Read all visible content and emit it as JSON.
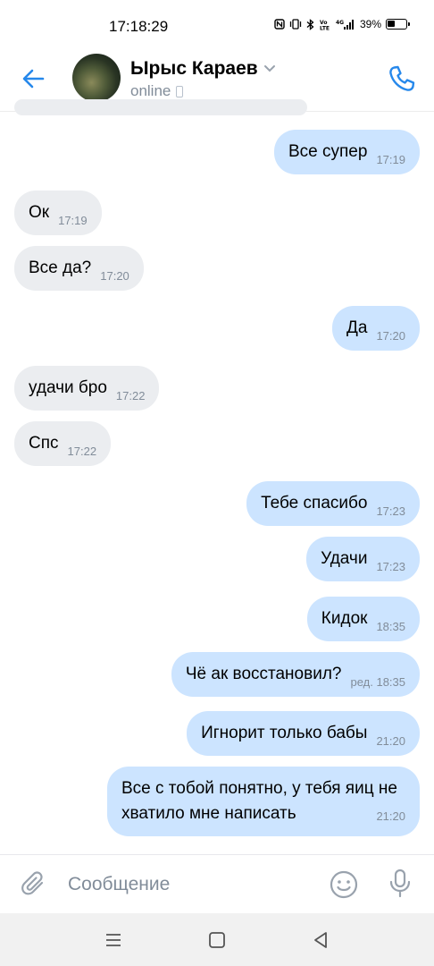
{
  "status_bar": {
    "time": "17:18:29",
    "indicators": [
      "nfc-icon",
      "vibrate-icon",
      "bluetooth-icon",
      "volte-icon",
      "signal-4g-icon"
    ],
    "battery": "39%"
  },
  "header": {
    "name": "Ырыс Караев",
    "status": "online"
  },
  "messages": [
    {
      "dir": "out",
      "text": "Все супер",
      "time": "17:19"
    },
    {
      "dir": "in",
      "text": "Ок",
      "time": "17:19"
    },
    {
      "dir": "in",
      "text": "Все да?",
      "time": "17:20"
    },
    {
      "dir": "out",
      "text": "Да",
      "time": "17:20"
    },
    {
      "dir": "in",
      "text": "удачи бро",
      "time": "17:22"
    },
    {
      "dir": "in",
      "text": "Спс",
      "time": "17:22"
    },
    {
      "dir": "out",
      "text": "Тебе спасибо",
      "time": "17:23"
    },
    {
      "dir": "out",
      "text": "Удачи",
      "time": "17:23"
    },
    {
      "dir": "out",
      "text": "Кидок",
      "time": "18:35"
    },
    {
      "dir": "out",
      "text": "Чё ак восстановил?",
      "time": "ред. 18:35"
    },
    {
      "dir": "out",
      "text": "Игнорит только бабы",
      "time": "21:20"
    },
    {
      "dir": "out",
      "text": "Все с тобой понятно, у тебя яиц не хватило мне написать",
      "time": "21:20"
    }
  ],
  "composer": {
    "placeholder": "Сообщение"
  },
  "colors": {
    "accent": "#2688eb",
    "incoming_bubble": "#ebedf0",
    "outgoing_bubble": "#cce4ff",
    "secondary_text": "#818c99"
  }
}
